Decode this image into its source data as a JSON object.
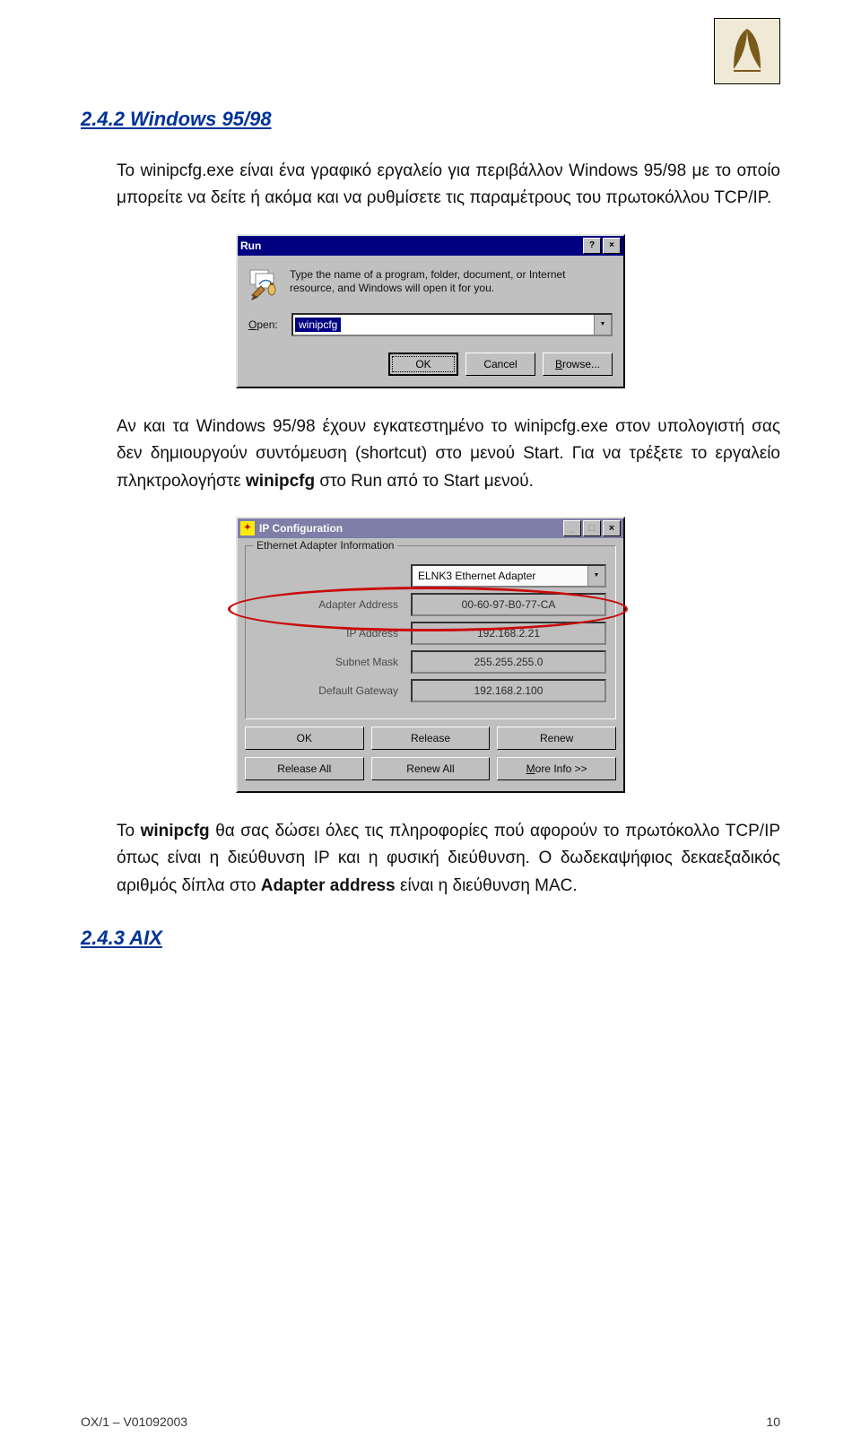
{
  "h242": "2.4.2 Windows 95/98",
  "p1a": "Το winipcfg.exe είναι ένα γραφικό εργαλείο για περιβάλλον Windows 95/98",
  "p1b": "με το οποίο μπορείτε να δείτε ή ακόμα και να ρυθμίσετε τις παραμέτρους του πρωτοκόλλου TCP/IP.",
  "run": {
    "title": "Run",
    "desc": "Type the name of a program, folder, document, or Internet resource, and Windows will open it for you.",
    "open_u": "O",
    "open_rest": "pen:",
    "value": "winipcfg",
    "ok": "OK",
    "cancel": "Cancel",
    "browse_u": "B",
    "browse_rest": "rowse..."
  },
  "p2a": "Αν και τα Windows 95/98 έχουν εγκατεστημένο το winipcfg.exe στον υπολογιστή σας δεν δημιουργούν συντόμευση (shortcut) στο μενού Start. Για να τρέξετε το εργαλείο πληκτρολογήστε",
  "p2b": "winipcfg",
  "p2c": "στο Run από το Start μενού.",
  "ip": {
    "title": "IP Configuration",
    "group": "Ethernet Adapter Information",
    "adapter": "ELNK3 Ethernet Adapter",
    "rows": [
      {
        "label": "Adapter Address",
        "value": "00-60-97-B0-77-CA"
      },
      {
        "label": "IP Address",
        "value": "192.168.2.21"
      },
      {
        "label": "Subnet Mask",
        "value": "255.255.255.0"
      },
      {
        "label": "Default Gateway",
        "value": "192.168.2.100"
      }
    ],
    "buttons": [
      "OK",
      "Release",
      "Renew",
      "Release All",
      "Renew All"
    ],
    "more_u": "M",
    "more_rest": "ore Info >>"
  },
  "p3a": "Το",
  "p3b": "winipcfg",
  "p3c": "θα σας δώσει όλες τις πληροφορίες πού αφορούν το πρωτόκολλο TCP/IP όπως είναι η διεύθυνση IP και η φυσική διεύθυνση. Ο δωδεκαψήφιος δεκαεξαδικός αριθμός δίπλα στο",
  "p3d": "Adapter address",
  "p3e": "είναι η διεύθυνση MAC.",
  "h243": "2.4.3 AIX",
  "footer": {
    "left": "OX/1 – V01092003",
    "right": "10"
  }
}
